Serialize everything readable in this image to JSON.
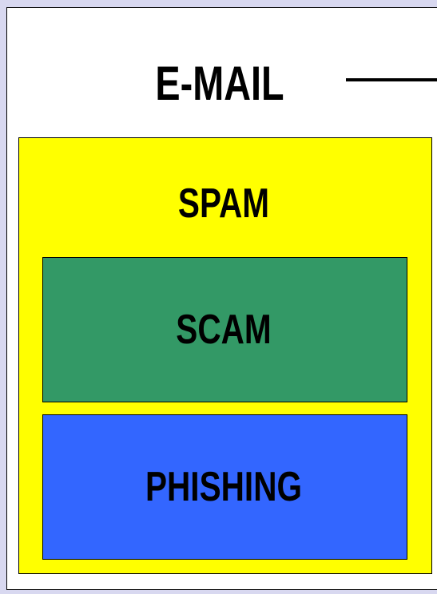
{
  "diagram": {
    "email": {
      "label": "E-MAIL",
      "color": "#ffffff"
    },
    "spam": {
      "label": "SPAM",
      "color": "#ffff00"
    },
    "scam": {
      "label": "SCAM",
      "color": "#339966"
    },
    "phishing": {
      "label": "PHISHING",
      "color": "#3366ff"
    },
    "background_color": "#d8d8f0",
    "border_color": "#000000"
  }
}
